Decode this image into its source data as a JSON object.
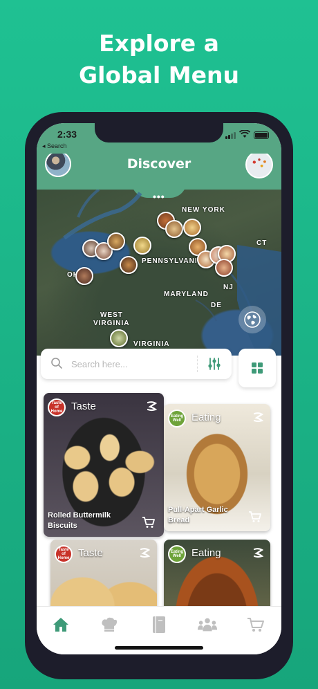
{
  "headline": {
    "line1": "Explore a",
    "line2": "Global Menu"
  },
  "status_bar": {
    "time": "2:33",
    "back_label": "◂ Search"
  },
  "header": {
    "title": "Discover"
  },
  "map": {
    "labels": {
      "new_york": "NEW YORK",
      "ct": "CT",
      "pennsylvania": "PENNSYLVANIA",
      "oh": "OH",
      "nj": "NJ",
      "maryland": "MARYLAND",
      "de": "DE",
      "west": "WEST",
      "virginia_w": "VIRGINIA",
      "virginia": "VIRGINIA"
    },
    "menu_dots": "•••"
  },
  "search": {
    "placeholder": "Search here..."
  },
  "cards": [
    {
      "source": "Taste",
      "logo_text": "Taste of Home",
      "title": "Rolled Buttermilk Biscuits"
    },
    {
      "source": "Eating",
      "logo_text": "Eating Well",
      "title": "Pull-Apart Garlic Bread"
    },
    {
      "source": "Taste",
      "logo_text": "Taste of Home",
      "title": ""
    },
    {
      "source": "Eating",
      "logo_text": "Eating Well",
      "title": ""
    }
  ],
  "colors": {
    "accent": "#57a684",
    "background": "#1fc192",
    "active_tab": "#3e9a78",
    "inactive_tab": "#bfbfbf"
  },
  "tabs": [
    {
      "icon": "home-icon",
      "active": true
    },
    {
      "icon": "chef-hat-icon",
      "active": false
    },
    {
      "icon": "recipe-book-icon",
      "active": false
    },
    {
      "icon": "community-icon",
      "active": false
    },
    {
      "icon": "cart-icon",
      "active": false
    }
  ]
}
